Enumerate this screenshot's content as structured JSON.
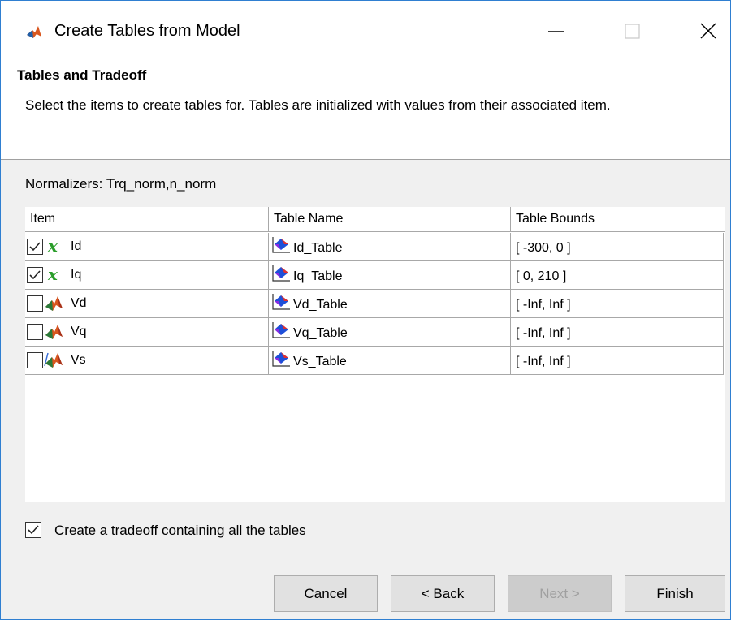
{
  "window": {
    "title": "Create Tables from Model",
    "icon": "matlab-icon"
  },
  "header": {
    "title": "Tables and Tradeoff",
    "description": "Select the items to create tables for. Tables are initialized with values from their associated item."
  },
  "normalizers": "Normalizers: Trq_norm,n_norm",
  "table": {
    "columns": [
      "Item",
      "Table Name",
      "Table Bounds"
    ],
    "rows": [
      {
        "checked": true,
        "icon": "variable-x-icon",
        "item": "Id",
        "table_name": "Id_Table",
        "bounds": "[ -300, 0 ]"
      },
      {
        "checked": true,
        "icon": "variable-x-icon",
        "item": "Iq",
        "table_name": "Iq_Table",
        "bounds": "[ 0, 210 ]"
      },
      {
        "checked": false,
        "icon": "matlab-model-icon",
        "item": "Vd",
        "table_name": "Vd_Table",
        "bounds": "[ -Inf, Inf ]"
      },
      {
        "checked": false,
        "icon": "matlab-model-icon",
        "item": "Vq",
        "table_name": "Vq_Table",
        "bounds": "[ -Inf, Inf ]"
      },
      {
        "checked": false,
        "icon": "matlab-model-icon",
        "item": "Vs",
        "table_name": "Vs_Table",
        "bounds": "[ -Inf, Inf ]"
      }
    ]
  },
  "tradeoff": {
    "checked": true,
    "label": "Create a tradeoff containing all the tables"
  },
  "buttons": {
    "cancel": "Cancel",
    "back": "< Back",
    "next": "Next >",
    "finish": "Finish"
  }
}
